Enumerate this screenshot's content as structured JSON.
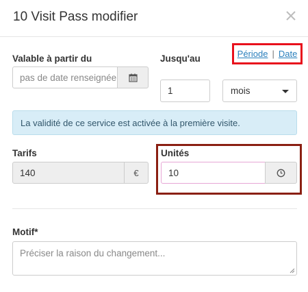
{
  "dialog": {
    "title": "10 Visit Pass modifier"
  },
  "validity": {
    "from_label": "Valable à partir du",
    "from_placeholder": "pas de date renseignée",
    "until_label": "Jusqu'au",
    "mode_links": {
      "period": "Période",
      "separator": "|",
      "date": "Date"
    },
    "duration_value": "1",
    "duration_unit": "mois",
    "info_message": "La validité de ce service est activée à la première visite."
  },
  "pricing": {
    "tarifs_label": "Tarifs",
    "tarifs_value": "140",
    "currency": "€",
    "units_label": "Unités",
    "units_value": "10"
  },
  "reason": {
    "label": "Motif*",
    "placeholder": "Préciser la raison du changement..."
  },
  "icons": {
    "close": "close-icon",
    "calendar": "calendar-icon",
    "clock": "clock-icon",
    "dropdown": "chevron-down-icon"
  },
  "colors": {
    "link": "#2a7fbc",
    "info_bg": "#d8edf7",
    "highlight_red": "#e8101c",
    "highlight_dark": "#8a1f12"
  }
}
